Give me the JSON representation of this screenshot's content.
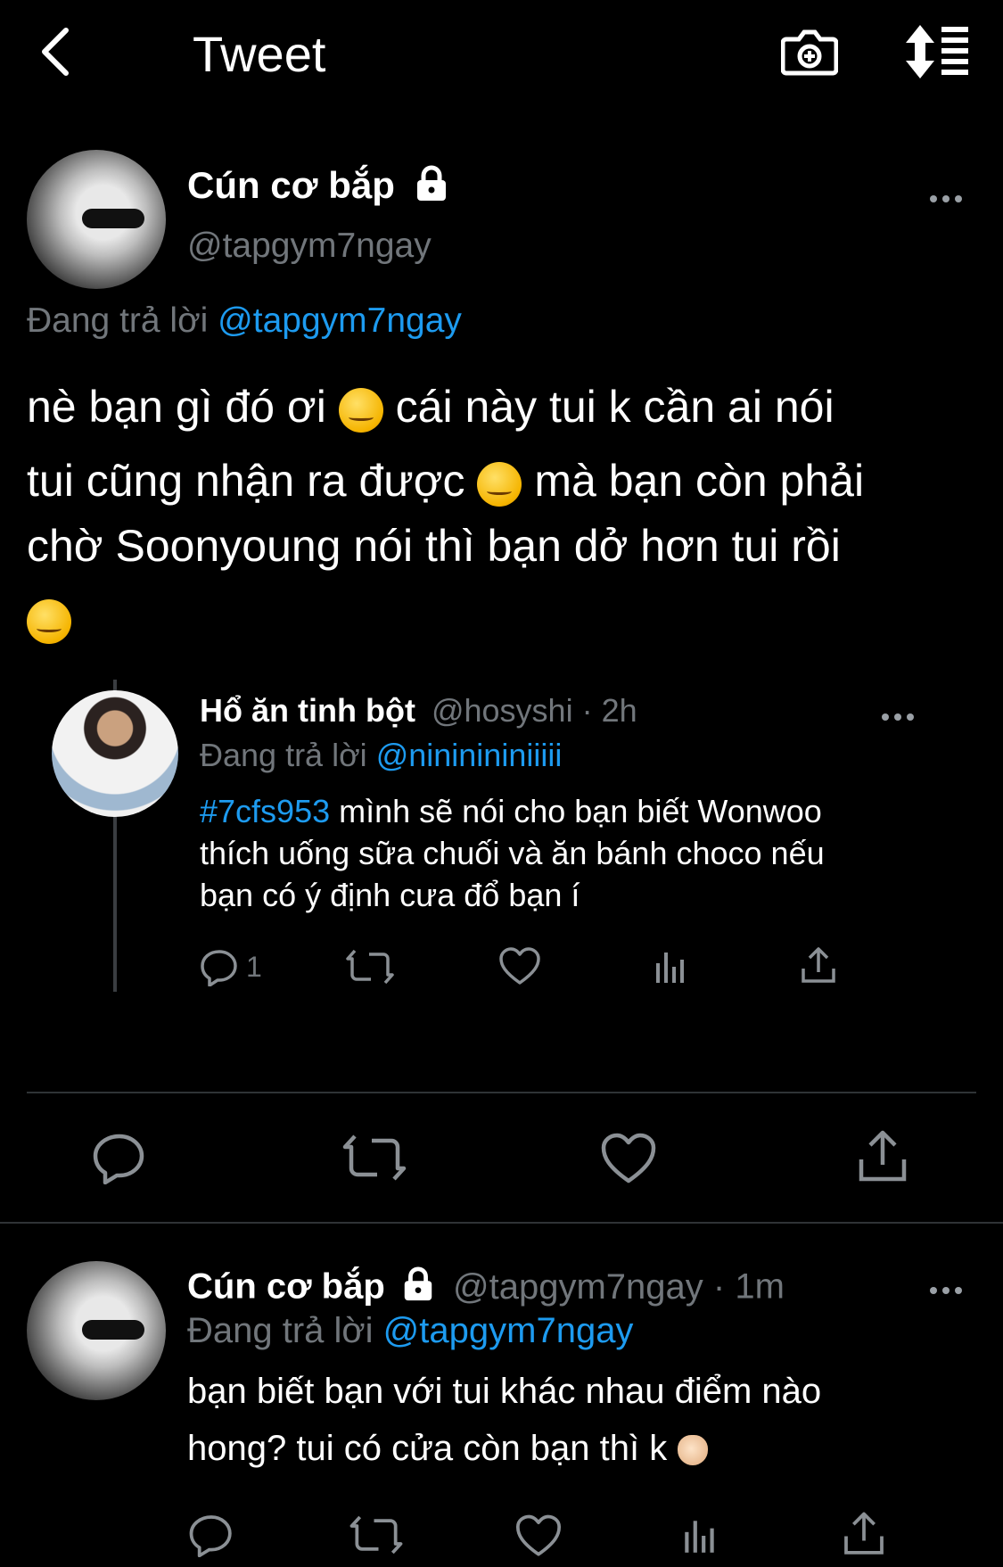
{
  "header": {
    "title": "Tweet",
    "icons": [
      "back-chevron-icon",
      "camera-plus-icon",
      "sort-list-icon"
    ]
  },
  "tweet": {
    "display_name": "Cún cơ bắp",
    "handle": "@tapgym7ngay",
    "replying_prefix": "Đang trả lời",
    "replying_to": "@tapgym7ngay",
    "text_line1a": "nè bạn gì đó ơi",
    "text_line1b": "cái này tui k cần ai nói",
    "text_line2a": "tui cũng nhận ra được",
    "text_line2b": "mà bạn còn phải",
    "text_line3": "chờ Soonyoung nói thì bạn dở hơn tui rồi"
  },
  "quoted": {
    "display_name": "Hổ ăn tinh bột",
    "handle": "@hosyshi",
    "time": "· 2h",
    "replying_prefix": "Đang trả lời",
    "replying_to": "@nininininiiiii",
    "hashtag": "#7cfs953",
    "text_line1": "mình sẽ nói cho bạn biết Wonwoo",
    "text_line2": "thích uống sữa chuối và ăn bánh choco nếu",
    "text_line3": "bạn có ý định cưa đổ bạn í",
    "reply_count": "1"
  },
  "reply": {
    "display_name": "Cún cơ bắp",
    "handle": "@tapgym7ngay",
    "time": "· 1m",
    "replying_prefix": "Đang trả lời",
    "replying_to": "@tapgym7ngay",
    "text_line1": "bạn biết bạn với tui khác nhau điểm nào",
    "text_line2": "hong? tui có cửa còn bạn thì k"
  },
  "colors": {
    "background": "#000000",
    "link": "#1d9bf0",
    "muted": "#71767b"
  }
}
